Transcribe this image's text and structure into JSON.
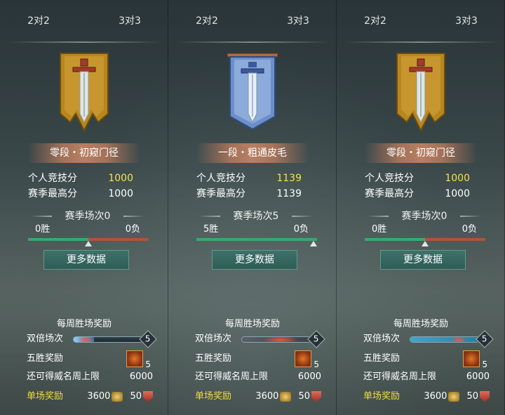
{
  "panels": [
    {
      "tabs": {
        "two": "2对2",
        "three": "3对3"
      },
      "emblem": "gold-sword-banner-icon",
      "rank": "零段・初窥门径",
      "stats": {
        "personal_label": "个人竞技分",
        "personal_value": "1000",
        "best_label": "赛季最高分",
        "best_value": "1000"
      },
      "season": {
        "title": "赛季场次0",
        "wins": "0胜",
        "losses": "0负",
        "win_ratio": 0.5
      },
      "more_button": "更多数据",
      "weekly": {
        "title": "每周胜场奖励",
        "double_label": "双倍场次",
        "double_count": "5",
        "five_win_label": "五胜奖励",
        "five_win_count": "5",
        "prestige_label": "还可得威名周上限",
        "prestige_value": "6000",
        "single_label": "单场奖励",
        "single_coin": "3600",
        "single_shield": "50"
      }
    },
    {
      "tabs": {
        "two": "2对2",
        "three": "3对3"
      },
      "emblem": "blue-sword-banner-icon",
      "rank": "一段・粗通皮毛",
      "stats": {
        "personal_label": "个人竞技分",
        "personal_value": "1139",
        "best_label": "赛季最高分",
        "best_value": "1139"
      },
      "season": {
        "title": "赛季场次5",
        "wins": "5胜",
        "losses": "0负",
        "win_ratio": 1.0
      },
      "more_button": "更多数据",
      "weekly": {
        "title": "每周胜场奖励",
        "double_label": "双倍场次",
        "double_count": "5",
        "five_win_label": "五胜奖励",
        "five_win_count": "5",
        "prestige_label": "还可得威名周上限",
        "prestige_value": "6000",
        "single_label": "单场奖励",
        "single_coin": "3600",
        "single_shield": "50"
      }
    },
    {
      "tabs": {
        "two": "2对2",
        "three": "3对3"
      },
      "emblem": "gold-sword-banner-icon",
      "rank": "零段・初窥门径",
      "stats": {
        "personal_label": "个人竞技分",
        "personal_value": "1000",
        "best_label": "赛季最高分",
        "best_value": "1000"
      },
      "season": {
        "title": "赛季场次0",
        "wins": "0胜",
        "losses": "0负",
        "win_ratio": 0.5
      },
      "more_button": "更多数据",
      "weekly": {
        "title": "每周胜场奖励",
        "double_label": "双倍场次",
        "double_count": "5",
        "five_win_label": "五胜奖励",
        "five_win_count": "5",
        "prestige_label": "还可得威名周上限",
        "prestige_value": "6000",
        "single_label": "单场奖励",
        "single_coin": "3600",
        "single_shield": "50"
      }
    }
  ],
  "colors": {
    "highlight_score": "#f5e24a",
    "single_reward_label": "#f2dc39",
    "win_bar": "#3aa86e",
    "loss_bar": "#b2523a",
    "button_bg": "#3d7169"
  }
}
